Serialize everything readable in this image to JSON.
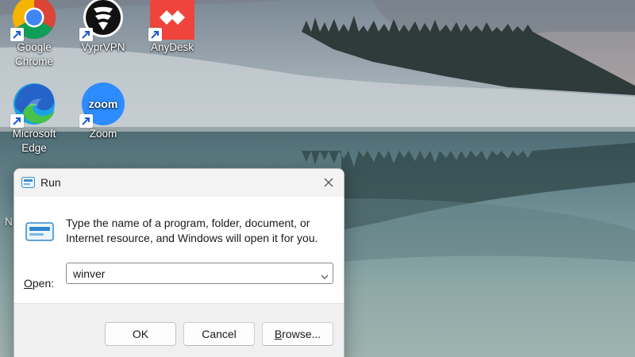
{
  "desktop": {
    "icons": [
      {
        "label_line1": "Google",
        "label_line2": "Chrome",
        "icon": "google-chrome-icon"
      },
      {
        "label_line1": "VyprVPN",
        "label_line2": "",
        "icon": "vyprvpn-icon"
      },
      {
        "label_line1": "AnyDesk",
        "label_line2": "",
        "icon": "anydesk-icon"
      },
      {
        "label_line1": "Microsoft",
        "label_line2": "Edge",
        "icon": "microsoft-edge-icon"
      },
      {
        "label_line1": "Zoom",
        "label_line2": "",
        "icon": "zoom-icon",
        "tile_text": "zoom"
      }
    ],
    "partial_label": "N"
  },
  "run_dialog": {
    "title": "Run",
    "description": "Type the name of a program, folder, document, or Internet resource, and Windows will open it for you.",
    "open_label_accel": "O",
    "open_label_rest": "pen:",
    "input_value": "winver",
    "buttons": {
      "ok": "OK",
      "cancel": "Cancel",
      "browse_accel": "B",
      "browse_rest": "rowse..."
    }
  },
  "colors": {
    "anydesk_red": "#ef443b",
    "zoom_blue": "#2d8cff",
    "dialog_footer": "#f0f0f0"
  }
}
